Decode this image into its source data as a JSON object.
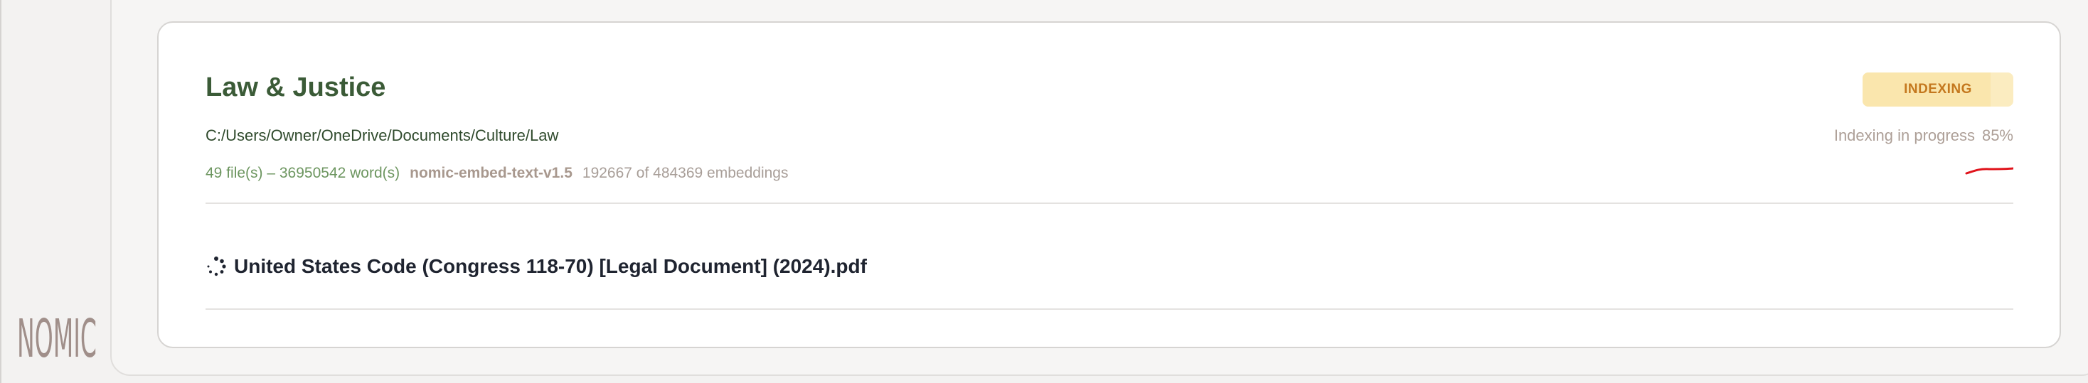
{
  "logo": {
    "text": "NOMIC",
    "color": "#a08f8a"
  },
  "collection": {
    "title": "Law & Justice",
    "path": "C:/Users/Owner/OneDrive/Documents/Culture/Law",
    "files_words": "49 file(s) – 36950542 word(s)",
    "model": "nomic-embed-text-v1.5",
    "embeddings": "192667 of 484369 embeddings",
    "status_badge": "INDEXING",
    "progress_label": "Indexing in progress",
    "progress_percent": "85%",
    "progress_value": 0.85,
    "files": [
      {
        "name": "United States Code (Congress 118-70) [Legal Document] (2024).pdf",
        "icon": "loading-spinner-icon"
      }
    ]
  },
  "colors": {
    "title_green": "#3b5b37",
    "stats_green": "#6d9660",
    "badge_bg": "#fbecc0",
    "badge_text": "#c4781e",
    "annotation_red": "#e0141c"
  }
}
